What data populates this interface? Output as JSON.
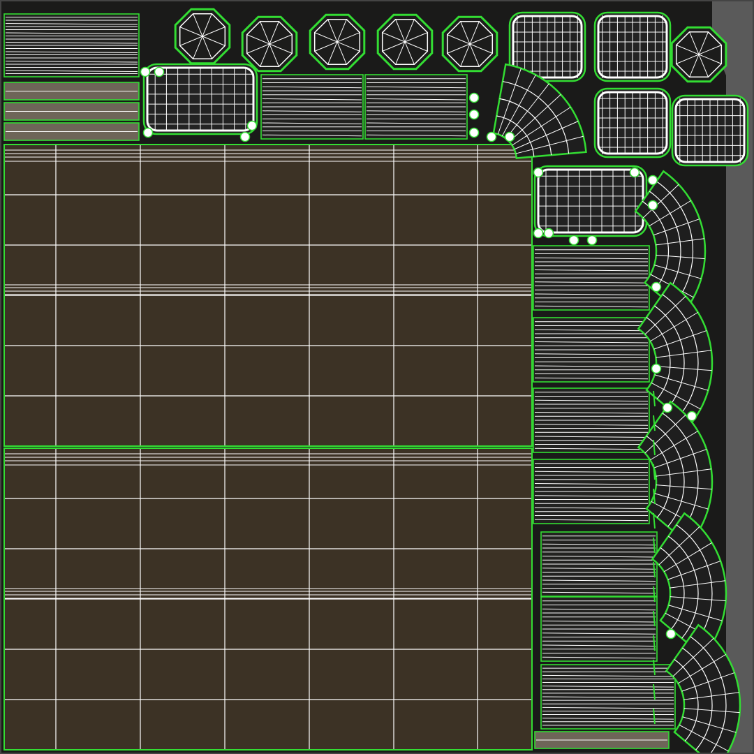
{
  "viewport": {
    "title": "",
    "colors": {
      "background": "#5a5a5a",
      "texture_dark": "#1a1a19",
      "wood": "#3c3225",
      "wood_light": "#6e6558",
      "seam": "#33dd33",
      "wire": "#ffffff"
    }
  },
  "uv_map": {
    "island_groups": [
      {
        "name": "table-top-planks",
        "count": 2
      },
      {
        "name": "plank-strips",
        "count": 16
      },
      {
        "name": "octagon-caps",
        "count": 6
      },
      {
        "name": "cushion-pieces",
        "count": 6
      },
      {
        "name": "curved-bands",
        "count": 6
      },
      {
        "name": "round-dots",
        "count": 30
      }
    ]
  }
}
